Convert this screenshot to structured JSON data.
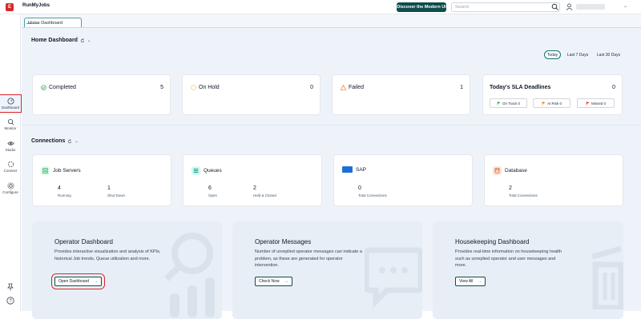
{
  "header": {
    "logo_letter": "E",
    "app_name": "RunMyJobs",
    "discover_label": "Discover the Modern UI",
    "search_placeholder": "Search"
  },
  "nav": {
    "items": [
      {
        "label": "Dashboard",
        "icon": "dashboard-icon",
        "active": true
      },
      {
        "label": "Monitor",
        "icon": "monitor-icon"
      },
      {
        "label": "Studio",
        "icon": "eye-icon"
      },
      {
        "label": "Connect",
        "icon": "connect-icon"
      },
      {
        "label": "Configure",
        "icon": "gear-icon"
      }
    ],
    "bottom": [
      "pin-icon",
      "help-icon"
    ]
  },
  "tab": {
    "label": "Home Dashboard"
  },
  "home": {
    "title": "Home Dashboard",
    "ranges": [
      "Today",
      "Last 7 Days",
      "Last 30 Days"
    ],
    "active_range": "Today",
    "statuses": [
      {
        "label": "Completed",
        "count": "5",
        "color": "#16a34a"
      },
      {
        "label": "On Hold",
        "count": "0",
        "color": "#f59e0b"
      },
      {
        "label": "Failed",
        "count": "1",
        "color": "#f97316"
      }
    ],
    "sla": {
      "title": "Today's SLA Deadlines",
      "count": "0",
      "buttons": [
        {
          "label": "On Track 0",
          "color": "#16a34a"
        },
        {
          "label": "At Risk 0",
          "color": "#d97706"
        },
        {
          "label": "Missed 0",
          "color": "#dc2626"
        }
      ]
    }
  },
  "connections": {
    "title": "Connections",
    "cards": [
      {
        "title": "Job Servers",
        "metrics": [
          {
            "value": "4",
            "label": "Running"
          },
          {
            "value": "1",
            "label": "Shut Down"
          }
        ]
      },
      {
        "title": "Queues",
        "metrics": [
          {
            "value": "6",
            "label": "Open"
          },
          {
            "value": "2",
            "label": "Held & Closed"
          }
        ]
      },
      {
        "title": "SAP",
        "metrics": [
          {
            "value": "0",
            "label": "Total Connections"
          }
        ]
      },
      {
        "title": "Database",
        "metrics": [
          {
            "value": "2",
            "label": "Total Connections"
          }
        ]
      }
    ]
  },
  "promos": [
    {
      "title": "Operator Dashboard",
      "desc": "Provides interactive visualization and analysis of KPIs, historical Job trends, Queue utilization and more.",
      "button": "Open Dashboard"
    },
    {
      "title": "Operator Messages",
      "desc": "Number of unreplied operator messages can indicate a problem, as these are generated for operator intervention.",
      "button": "Check Now"
    },
    {
      "title": "Housekeeping Dashboard",
      "desc": "Provides real-time information on housekeeping health such as unreplied operator and user messages and more.",
      "button": "View All"
    }
  ],
  "colors": {
    "accent": "#0f4c4c",
    "tab_border": "#4b9fa8",
    "highlight": "#dc2626"
  }
}
